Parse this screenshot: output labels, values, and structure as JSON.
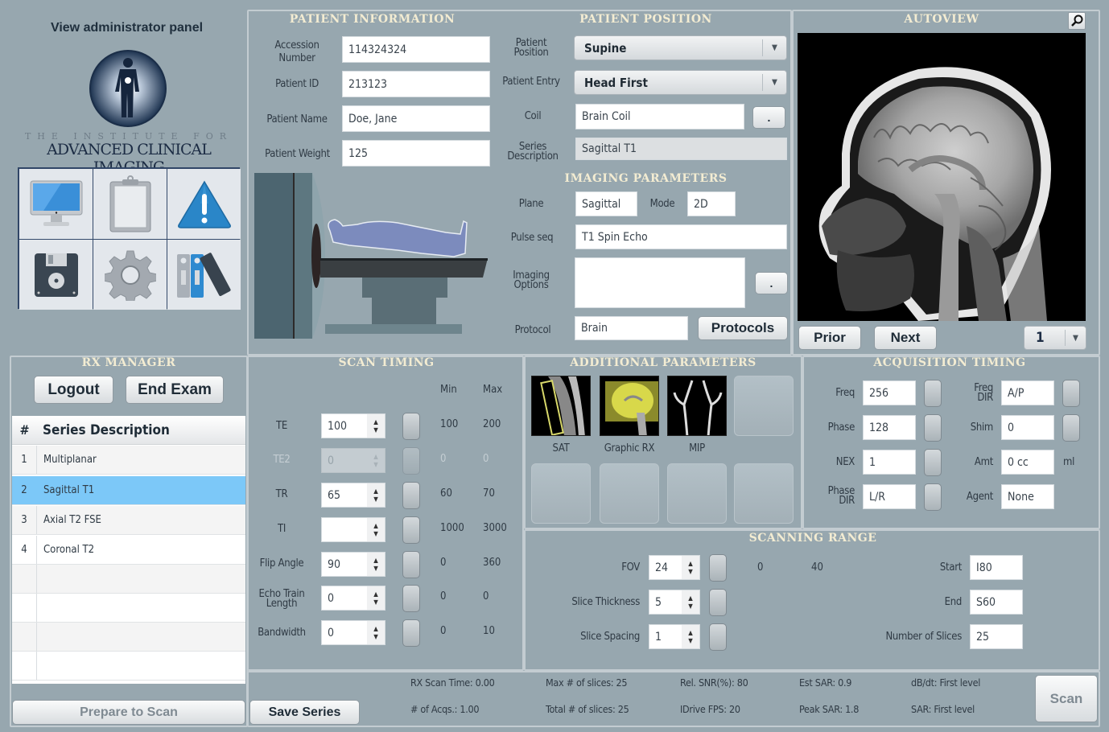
{
  "admin": {
    "link": "View administrator panel",
    "logo_small": "THE INSTITUTE FOR",
    "logo_big": "ADVANCED CLINICAL IMAGING"
  },
  "toolbar_icons": [
    {
      "name": "monitor-icon"
    },
    {
      "name": "clipboard-icon"
    },
    {
      "name": "warning-icon"
    },
    {
      "name": "floppy-disk-icon"
    },
    {
      "name": "gear-icon"
    },
    {
      "name": "binders-icon"
    }
  ],
  "patient_info": {
    "title": "PATIENT INFORMATION",
    "accession_label": "Accession Number",
    "accession_value": "114324324",
    "patient_id_label": "Patient ID",
    "patient_id_value": "213123",
    "patient_name_label": "Patient Name",
    "patient_name_value": "Doe, Jane",
    "patient_weight_label": "Patient Weight",
    "patient_weight_value": "125"
  },
  "patient_position": {
    "title": "PATIENT POSITION",
    "position_label": "Patient Position",
    "position_value": "Supine",
    "entry_label": "Patient Entry",
    "entry_value": "Head First",
    "coil_label": "Coil",
    "coil_value": "Brain Coil",
    "coil_button": ".",
    "series_desc_label": "Series Description",
    "series_desc_value": "Sagittal T1"
  },
  "imaging_params": {
    "title": "IMAGING PARAMETERS",
    "plane_label": "Plane",
    "plane_value": "Sagittal",
    "mode_label": "Mode",
    "mode_value": "2D",
    "pulse_label": "Pulse seq",
    "pulse_value": "T1 Spin Echo",
    "options_label": "Imaging Options",
    "options_value": "",
    "options_button": ".",
    "protocol_label": "Protocol",
    "protocol_value": "Brain",
    "protocols_button": "Protocols"
  },
  "autoview": {
    "title": "AUTOVIEW",
    "prior_button": "Prior",
    "next_button": "Next",
    "image_index": "1"
  },
  "rx_manager": {
    "title": "RX MANAGER",
    "logout_button": "Logout",
    "end_exam_button": "End Exam",
    "col_num": "#",
    "col_desc": "Series Description",
    "rows": [
      {
        "num": "1",
        "desc": "Multiplanar",
        "selected": false
      },
      {
        "num": "2",
        "desc": "Sagittal T1",
        "selected": true
      },
      {
        "num": "3",
        "desc": "Axial T2 FSE",
        "selected": false
      },
      {
        "num": "4",
        "desc": "Coronal T2",
        "selected": false
      }
    ],
    "prepare_button": "Prepare to Scan"
  },
  "scan_timing": {
    "title": "SCAN TIMING",
    "min_header": "Min",
    "max_header": "Max",
    "rows": [
      {
        "label": "TE",
        "value": "100",
        "min": "100",
        "max": "200",
        "disabled": false
      },
      {
        "label": "TE2",
        "value": "0",
        "min": "0",
        "max": "0",
        "disabled": true
      },
      {
        "label": "TR",
        "value": "65",
        "min": "60",
        "max": "70",
        "disabled": false
      },
      {
        "label": "TI",
        "value": "",
        "min": "1000",
        "max": "3000",
        "disabled": false
      },
      {
        "label": "Flip Angle",
        "value": "90",
        "min": "0",
        "max": "360",
        "disabled": false
      },
      {
        "label": "Echo Train Length",
        "value": "0",
        "min": "0",
        "max": "0",
        "disabled": false
      },
      {
        "label": "Bandwidth",
        "value": "0",
        "min": "0",
        "max": "10",
        "disabled": false
      }
    ]
  },
  "additional_params": {
    "title": "ADDITIONAL PARAMETERS",
    "items": [
      {
        "label": "SAT"
      },
      {
        "label": "Graphic RX"
      },
      {
        "label": "MIP"
      }
    ]
  },
  "acquisition_timing": {
    "title": "ACQUISITION TIMING",
    "freq_label": "Freq",
    "freq_value": "256",
    "phase_label": "Phase",
    "phase_value": "128",
    "nex_label": "NEX",
    "nex_value": "1",
    "phase_dir_label": "Phase DIR",
    "phase_dir_value": "L/R",
    "freq_dir_label": "Freq DIR",
    "freq_dir_value": "A/P",
    "shim_label": "Shim",
    "shim_value": "0",
    "amt_label": "Amt",
    "amt_value": "0 cc",
    "amt_unit": "ml",
    "agent_label": "Agent",
    "agent_value": "None"
  },
  "scanning_range": {
    "title": "SCANNING RANGE",
    "fov_label": "FOV",
    "fov_value": "24",
    "fov_min": "0",
    "fov_max": "40",
    "thickness_label": "Slice Thickness",
    "thickness_value": "5",
    "spacing_label": "Slice Spacing",
    "spacing_value": "1",
    "start_label": "Start",
    "start_value": "I80",
    "end_label": "End",
    "end_value": "S60",
    "slices_label": "Number of Slices",
    "slices_value": "25"
  },
  "footer": {
    "save_series_button": "Save Series",
    "scan_button": "Scan",
    "stats": {
      "rx_scan_time": "RX Scan Time: 0.00",
      "acqs": "# of Acqs.: 1.00",
      "max_slices": "Max # of slices: 25",
      "total_slices": "Total # of slices: 25",
      "rel_snr": "Rel. SNR(%): 80",
      "idrive_fps": "IDrive FPS: 20",
      "est_sar": "Est SAR: 0.9",
      "peak_sar": "Peak SAR: 1.8",
      "dbdt": "dB/dt: First level",
      "sar": "SAR: First level"
    }
  }
}
